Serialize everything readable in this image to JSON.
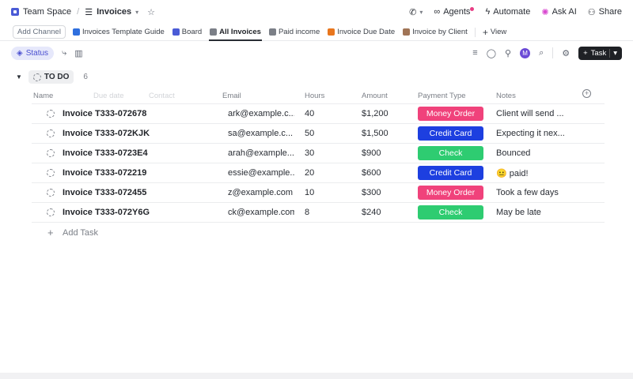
{
  "breadcrumb": {
    "space": "Team Space",
    "list": "Invoices"
  },
  "topbar": {
    "agents": "Agents",
    "automate": "Automate",
    "ask_ai": "Ask AI",
    "share": "Share"
  },
  "tabs": {
    "add_channel": "Add Channel",
    "items": [
      {
        "label": "Invoices Template Guide",
        "color": "#2f6fde"
      },
      {
        "label": "Board",
        "color": "#4a5bd6"
      },
      {
        "label": "All Invoices",
        "color": "#7b7f87"
      },
      {
        "label": "Paid income",
        "color": "#7b7f87"
      },
      {
        "label": "Invoice Due Date",
        "color": "#e8761d"
      },
      {
        "label": "Invoice by Client",
        "color": "#a07456"
      }
    ],
    "add_view": "View"
  },
  "filterbar": {
    "status_label": "Status",
    "avatar_initial": "M",
    "task_button": "Task"
  },
  "group": {
    "label": "TO DO",
    "count": "6"
  },
  "table": {
    "headers": {
      "name": "Name",
      "due_date": "Due date",
      "contact": "Contact",
      "email": "Email",
      "hours": "Hours",
      "amount": "Amount",
      "payment_type": "Payment Type",
      "notes": "Notes"
    },
    "rows": [
      {
        "name": "Invoice T333-072678",
        "email": "ark@example.c...",
        "hours": "40",
        "amount": "$1,200",
        "payment": "Money Order",
        "notes": "Client will send ..."
      },
      {
        "name": "Invoice T333-072KJK",
        "email": "sa@example.c...",
        "hours": "50",
        "amount": "$1,500",
        "payment": "Credit Card",
        "notes": "Expecting it nex..."
      },
      {
        "name": "Invoice T333-0723E4",
        "email": "arah@example....",
        "hours": "30",
        "amount": "$900",
        "payment": "Check",
        "notes": "Bounced"
      },
      {
        "name": "Invoice T333-072219",
        "email": "essie@example...",
        "hours": "20",
        "amount": "$600",
        "payment": "Credit Card",
        "notes": "😐 paid!"
      },
      {
        "name": "Invoice T333-072455",
        "email": "z@example.com",
        "hours": "10",
        "amount": "$300",
        "payment": "Money Order",
        "notes": "Took a few days"
      },
      {
        "name": "Invoice T333-072Y6G",
        "email": "ck@example.com",
        "hours": "8",
        "amount": "$240",
        "payment": "Check",
        "notes": "May be late"
      }
    ],
    "add_task": "Add Task"
  },
  "payment_colors": {
    "Money Order": "#f0427b",
    "Credit Card": "#1d3fe0",
    "Check": "#2ecc71"
  }
}
